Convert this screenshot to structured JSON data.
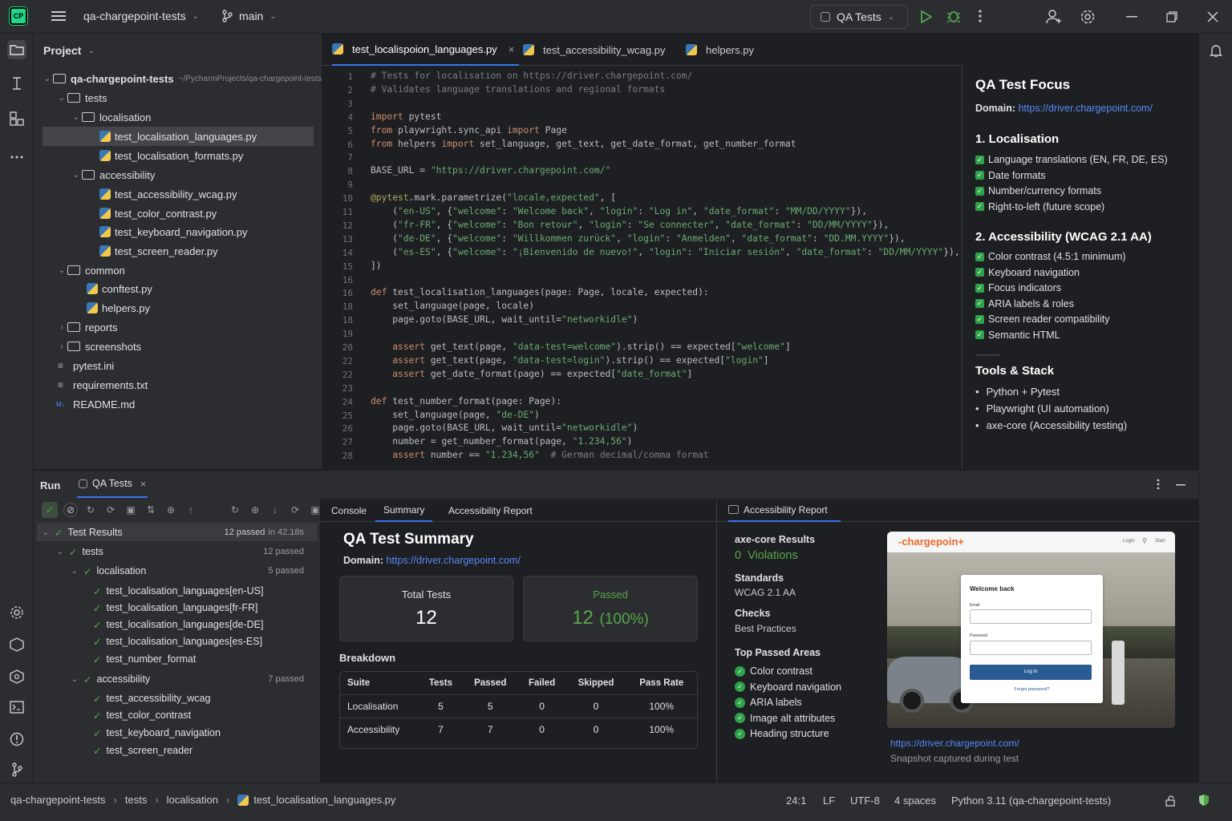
{
  "titlebar": {
    "logo": "CP",
    "project": "qa-chargepoint-tests",
    "branch": "main",
    "run_config": "QA Tests"
  },
  "project_panel": {
    "title": "Project",
    "root": "qa-chargepoint-tests",
    "root_path": "~/PycharmProjects/qa-chargepoint-tests",
    "items": [
      {
        "label": "tests"
      },
      {
        "label": "localisation"
      },
      {
        "label": "test_localisation_languages.py"
      },
      {
        "label": "test_localisation_formats.py"
      },
      {
        "label": "accessibility"
      },
      {
        "label": "test_accessibility_wcag.py"
      },
      {
        "label": "test_color_contrast.py"
      },
      {
        "label": "test_keyboard_navigation.py"
      },
      {
        "label": "test_screen_reader.py"
      },
      {
        "label": "common"
      },
      {
        "label": "conftest.py"
      },
      {
        "label": "helpers.py"
      },
      {
        "label": "reports"
      },
      {
        "label": "screenshots"
      },
      {
        "label": "pytest.ini"
      },
      {
        "label": "requirements.txt"
      },
      {
        "label": "README.md"
      }
    ]
  },
  "editor": {
    "tabs": [
      {
        "label": "test_localispoion_languages.py"
      },
      {
        "label": "test_accessibility_wcag.py"
      },
      {
        "label": "helpers.py"
      }
    ],
    "line_numbers": [
      "1",
      "2",
      "3",
      "4",
      "5",
      "6",
      "7",
      "8",
      "9",
      "10",
      "11",
      "12",
      "13",
      "14",
      "15",
      "16",
      "16",
      "18",
      "18",
      "19",
      "20",
      "22",
      "22",
      "23",
      "24",
      "25",
      "26",
      "27",
      "28",
      "24"
    ],
    "lines": [
      "# Tests for localisation on https://driver.chargepoint.com/",
      "# Validates language translations and regional formats",
      "",
      "import pytest",
      "from playwright.sync_api import Page",
      "from helpers import set_language, get_text, get_date_format, get_number_format",
      "",
      "BASE_URL = \"https://driver.chargepoint.com/\"",
      "",
      "@pytest.mark.parametrize(\"locale,expected\", [",
      "    (\"en-US\", {\"welcome\": \"Welcome back\", \"login\": \"Log in\", \"date_format\": \"MM/DD/YYYY\"}),",
      "    (\"fr-FR\", {\"welcome\": \"Bon retour\", \"login\": \"Se connecter\", \"date_format\": \"DD/MM/YYYY\"}),",
      "    (\"de-DE\", {\"welcome\": \"Willkommen zurück\", \"login\": \"Anmelden\", \"date_format\": \"DD.MM.YYYY\"}),",
      "    (\"es-ES\", {\"welcome\": \"¡Bienvenido de nuevo!\", \"login\": \"Iniciar sesión\", \"date_format\": \"DD/MM/YYYY\"}),",
      "])",
      "",
      "def test_localisation_languages(page: Page, locale, expected):",
      "    set_language(page, locale)",
      "    page.goto(BASE_URL, wait_until=\"networkidle\")",
      "",
      "    assert get_text(page, \"data-test=welcome\").strip() == expected[\"welcome\"]",
      "    assert get_text(page, \"data-test=login\").strip() == expected[\"login\"]",
      "    assert get_date_format(page) == expected[\"date_format\"]",
      "",
      "def test_number_format(page: Page):",
      "    set_language(page, \"de-DE\")",
      "    page.goto(BASE_URL, wait_until=\"networkidle\")",
      "    number = get_number_format(page, \"1.234,56\")",
      "    assert number == \"1.234,56\"  # German decimal/comma format"
    ]
  },
  "focus_panel": {
    "title": "QA Test Focus",
    "domain_label": "Domain:",
    "domain_url": "https://driver.chargepoint.com/",
    "sec1_title": "1. Localisation",
    "sec1_items": [
      "Language translations (EN, FR, DE, ES)",
      "Date formats",
      "Number/currency formats",
      "Right-to-left (future scope)"
    ],
    "sec2_title": "2. Accessibility (WCAG 2.1 AA)",
    "sec2_items": [
      "Color contrast (4.5:1 minimum)",
      "Keyboard navigation",
      "Focus indicators",
      "ARIA labels & roles",
      "Screen reader compatibility",
      "Semantic HTML"
    ],
    "sec3_title": "Tools & Stack",
    "sec3_items": [
      "Python + Pytest",
      "Playwright (UI automation)",
      "axe-core (Accessibility testing)"
    ]
  },
  "run_panel": {
    "run_label": "Run",
    "tab_label": "QA Tests",
    "tree": [
      {
        "label": "Test Results",
        "right": "12 passed",
        "time": "in 42.18s"
      },
      {
        "label": "tests",
        "right": "12 passed"
      },
      {
        "label": "localisation",
        "right": "5 passed"
      },
      {
        "label": "test_localisation_languages[en-US]"
      },
      {
        "label": "test_localisation_languages[fr-FR]"
      },
      {
        "label": "test_localisation_languages[de-DE]"
      },
      {
        "label": "test_localisation_languages[es-ES]"
      },
      {
        "label": "test_number_format"
      },
      {
        "label": "accessibility",
        "right": "7 passed"
      },
      {
        "label": "test_accessibility_wcag"
      },
      {
        "label": "test_color_contrast"
      },
      {
        "label": "test_keyboard_navigation"
      },
      {
        "label": "test_screen_reader"
      }
    ]
  },
  "summary": {
    "tabs": [
      "Console",
      "Summary",
      "Accessibility Report"
    ],
    "title": "QA Test Summary",
    "domain_label": "Domain:",
    "domain_url": "https://driver.chargepoint.com/",
    "total_label": "Total Tests",
    "total_value": "12",
    "passed_label": "Passed",
    "passed_value": "12",
    "passed_pct": "(100%)",
    "breakdown_label": "Breakdown",
    "columns": [
      "Suite",
      "Tests",
      "Passed",
      "Failed",
      "Skipped",
      "Pass Rate"
    ],
    "rows": [
      [
        "Localisation",
        "5",
        "5",
        "0",
        "0",
        "100%"
      ],
      [
        "Accessibility",
        "7",
        "7",
        "0",
        "0",
        "100%"
      ]
    ]
  },
  "access_report": {
    "tab": "Accessibility Report",
    "axe_title": "axe-core Results",
    "violations": "0  Violations",
    "standards_label": "Standards",
    "standards_value": "WCAG 2.1 AA",
    "checks_label": "Checks",
    "checks_value": "Best Practices",
    "top_label": "Top Passed Areas",
    "top_items": [
      "Color contrast",
      "Keyboard navigation",
      "ARIA labels",
      "Image alt attributes",
      "Heading structure"
    ],
    "snapshot_url": "https://driver.chargepoint.com/",
    "snapshot_caption": "Snapshot captured during test",
    "shot": {
      "brand": "-chargepoin+",
      "nav_login": "Login",
      "nav_start": "Start",
      "welcome": "Welcome back",
      "email": "Email",
      "password": "Password",
      "login_btn": "Log in",
      "forgot": "Forgot password?"
    }
  },
  "statusbar": {
    "crumbs": [
      "qa-chargepoint-tests",
      "tests",
      "localisation",
      "test_localisation_languages.py"
    ],
    "position": "24:1",
    "line_sep": "LF",
    "encoding": "UTF-8",
    "indent": "4 spaces",
    "interpreter": "Python 3.11 (qa-chargepoint-tests)"
  },
  "colors": {
    "accent": "#3574f0",
    "pass": "#57a64a",
    "link": "#548af7",
    "bg": "#1e1f22",
    "panel": "#2b2d30"
  }
}
